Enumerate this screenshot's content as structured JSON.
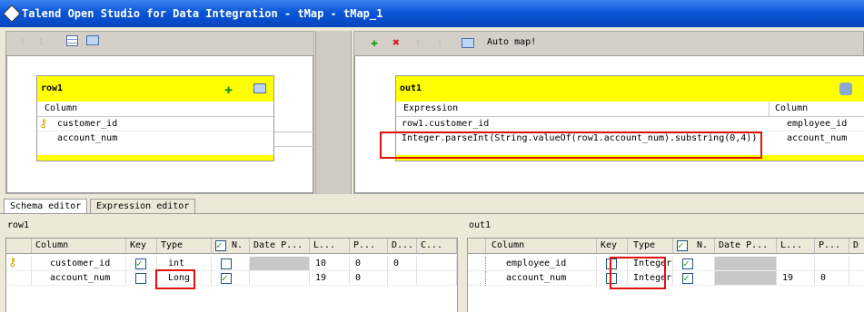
{
  "window": {
    "title": "Talend Open Studio for Data Integration - tMap - tMap_1"
  },
  "left_toolbar": {
    "icons": [
      "arrow-up-icon",
      "arrow-down-icon",
      "table-icon",
      "monitor-icon"
    ]
  },
  "right_toolbar": {
    "auto_map": "Auto map!"
  },
  "input_table": {
    "name": "row1",
    "column_header": "Column",
    "rows": [
      {
        "name": "customer_id",
        "key": true
      },
      {
        "name": "account_num",
        "key": false
      }
    ]
  },
  "output_table": {
    "name": "out1",
    "expression_header": "Expression",
    "column_header": "Column",
    "rows": [
      {
        "expression": "row1.customer_id",
        "column": "employee_id"
      },
      {
        "expression": "Integer.parseInt(String.valueOf(row1.account_num).substring(0,4))",
        "column": "account_num"
      }
    ]
  },
  "tabs": [
    {
      "label": "Schema editor",
      "active": true
    },
    {
      "label": "Expression editor",
      "active": false
    }
  ],
  "schema_left": {
    "title": "row1",
    "headers": [
      "Column",
      "Key",
      "Type",
      "N.",
      "Date P...",
      "L...",
      "P...",
      "D...",
      "C..."
    ],
    "rows": [
      {
        "column": "customer_id",
        "key": true,
        "type": "int",
        "nullable": false,
        "length": "10",
        "precision": "0",
        "default": "0"
      },
      {
        "column": "account_num",
        "key": false,
        "type": "Long",
        "nullable": true,
        "length": "19",
        "precision": "0",
        "default": ""
      }
    ]
  },
  "schema_right": {
    "title": "out1",
    "headers": [
      "Column",
      "Key",
      "Type",
      "N.",
      "Date P...",
      "L...",
      "P...",
      "D"
    ],
    "rows": [
      {
        "column": "employee_id",
        "key": false,
        "type": "Integer",
        "nullable": true,
        "length": "",
        "precision": ""
      },
      {
        "column": "account_num",
        "key": false,
        "type": "Integer",
        "nullable": true,
        "length": "19",
        "precision": "0"
      }
    ]
  },
  "colors": {
    "header_yellow": "#ffff00",
    "title_blue": "#0a56d6",
    "highlight_red": "#e01010"
  }
}
